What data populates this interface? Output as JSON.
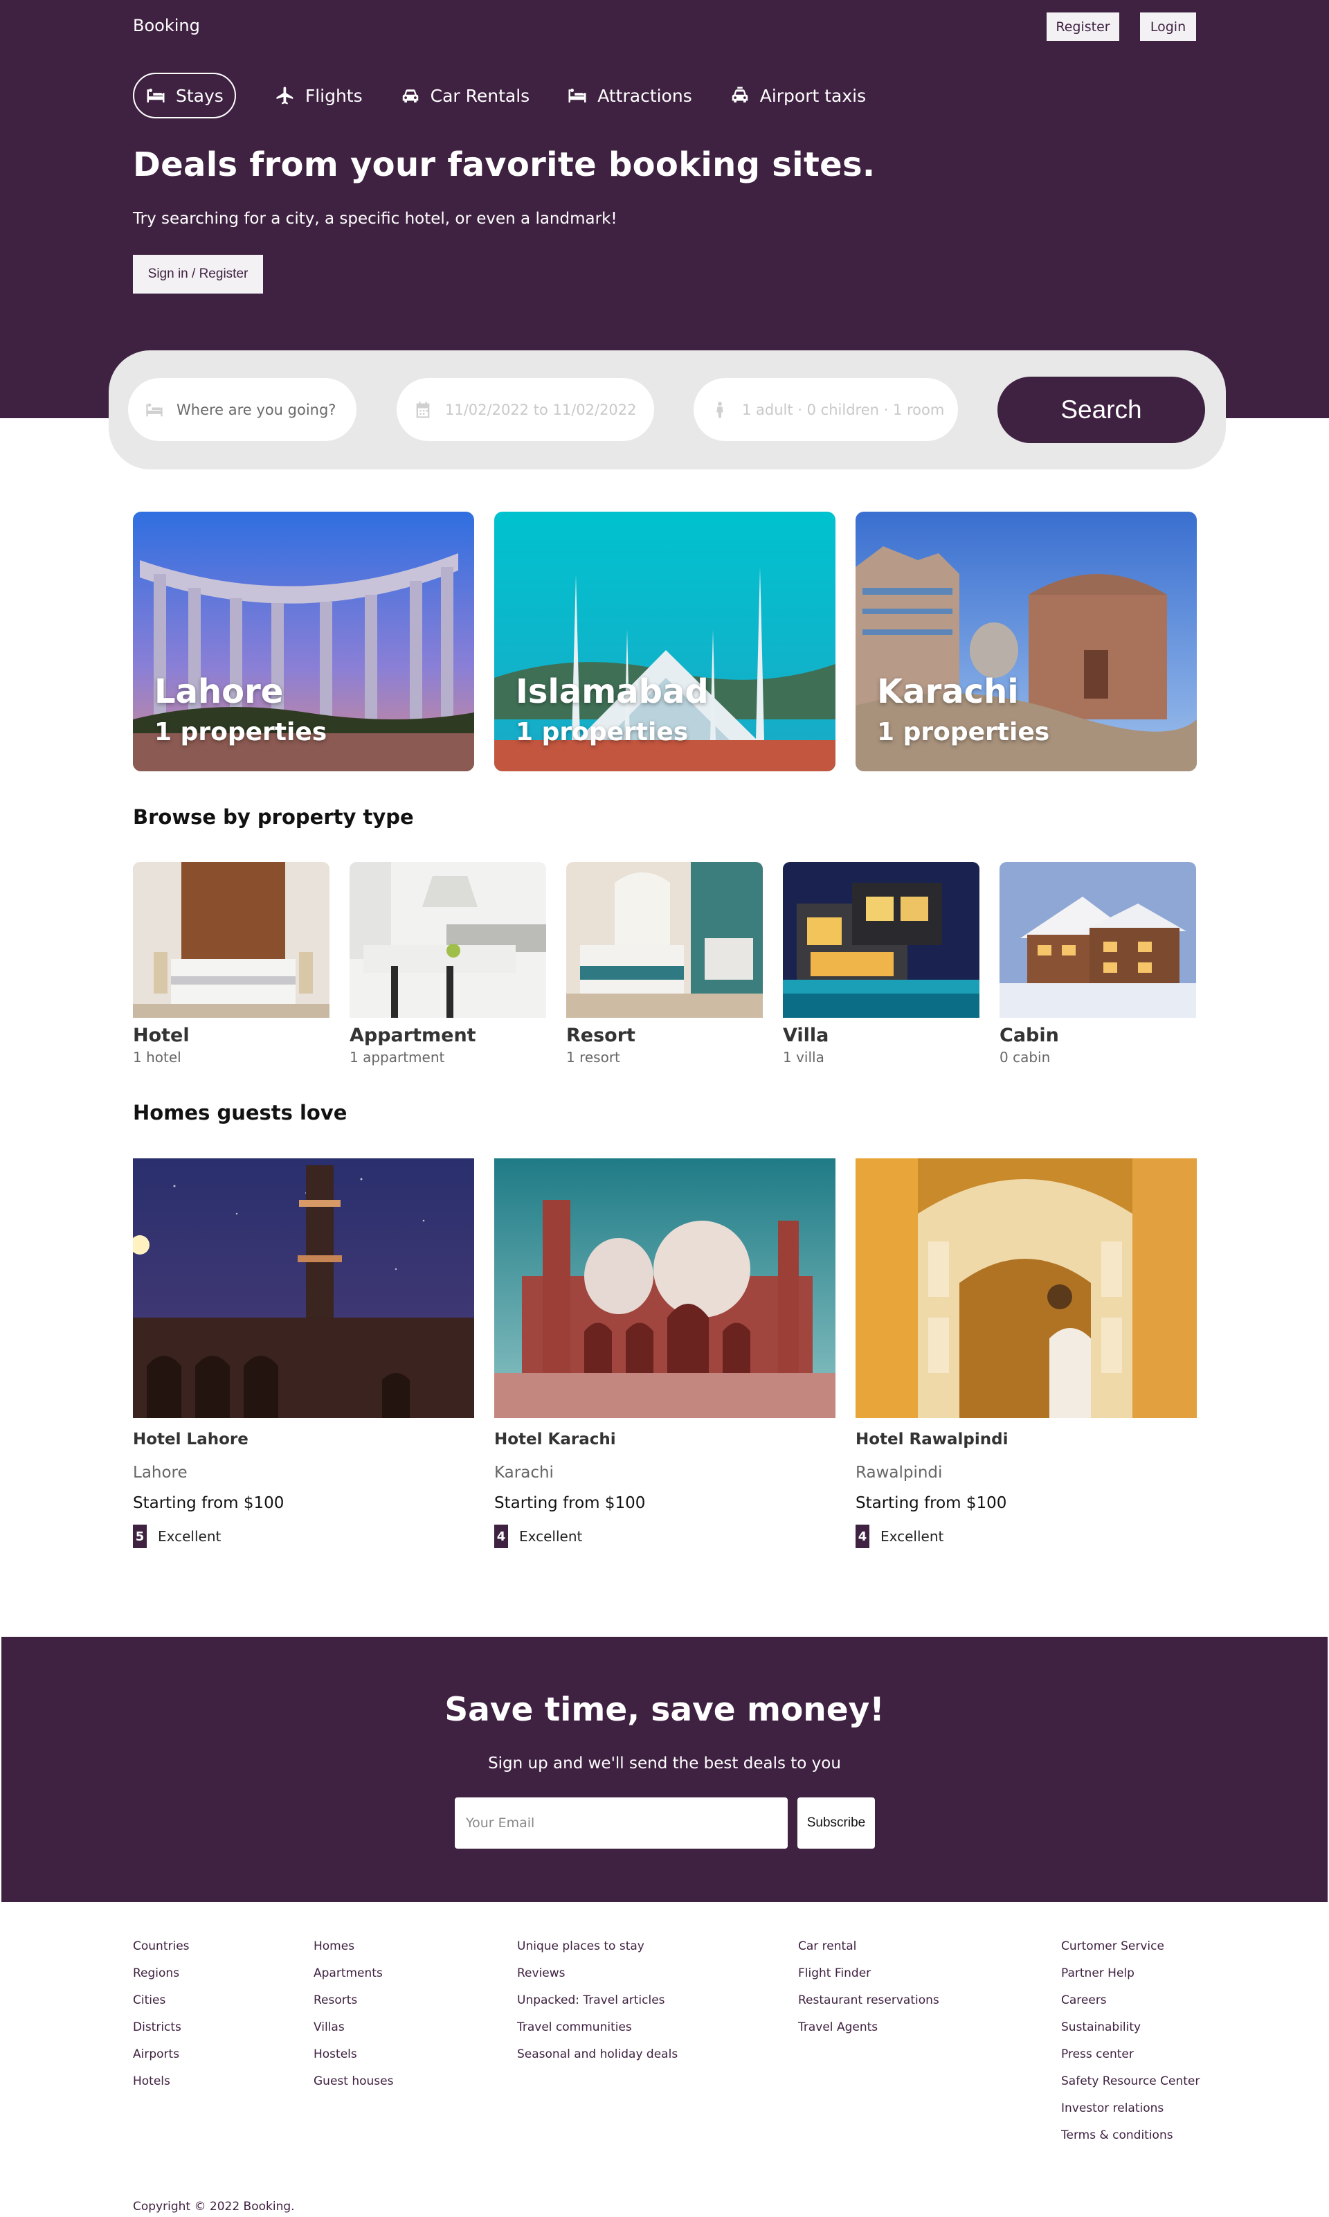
{
  "header": {
    "brand": "Booking",
    "register_label": "Register",
    "login_label": "Login",
    "nav": [
      {
        "label": "Stays",
        "icon": "bed-icon"
      },
      {
        "label": "Flights",
        "icon": "plane-icon"
      },
      {
        "label": "Car Rentals",
        "icon": "car-icon"
      },
      {
        "label": "Attractions",
        "icon": "bed-icon"
      },
      {
        "label": "Airport taxis",
        "icon": "taxi-icon"
      }
    ],
    "title": "Deals from your favorite booking sites.",
    "subtitle": "Try searching for a city, a specific hotel, or even a landmark!",
    "signin_label": "Sign in / Register"
  },
  "search": {
    "destination_placeholder": "Where are you going?",
    "dates": "11/02/2022 to 11/02/2022",
    "guests": "1 adult · 0 children · 1 room",
    "button_label": "Search"
  },
  "cities": [
    {
      "name": "Lahore",
      "count": "1 properties"
    },
    {
      "name": "Islamabad",
      "count": "1 properties"
    },
    {
      "name": "Karachi",
      "count": "1 properties"
    }
  ],
  "property_types": {
    "title": "Browse by property type",
    "items": [
      {
        "name": "Hotel",
        "count": "1 hotel"
      },
      {
        "name": "Appartment",
        "count": "1 appartment"
      },
      {
        "name": "Resort",
        "count": "1 resort"
      },
      {
        "name": "Villa",
        "count": "1 villa"
      },
      {
        "name": "Cabin",
        "count": "0 cabin"
      }
    ]
  },
  "homes": {
    "title": "Homes guests love",
    "items": [
      {
        "name": "Hotel Lahore",
        "city": "Lahore",
        "price": "Starting from $100",
        "score": "5",
        "rating": "Excellent"
      },
      {
        "name": "Hotel Karachi",
        "city": "Karachi",
        "price": "Starting from $100",
        "score": "4",
        "rating": "Excellent"
      },
      {
        "name": "Hotel Rawalpindi",
        "city": "Rawalpindi",
        "price": "Starting from $100",
        "score": "4",
        "rating": "Excellent"
      }
    ]
  },
  "newsletter": {
    "title": "Save time, save money!",
    "subtitle": "Sign up and we'll send the best deals to you",
    "email_placeholder": "Your Email",
    "subscribe_label": "Subscribe"
  },
  "footer": {
    "columns": [
      [
        "Countries",
        "Regions",
        "Cities",
        "Districts",
        "Airports",
        "Hotels"
      ],
      [
        "Homes",
        "Apartments",
        "Resorts",
        "Villas",
        "Hostels",
        "Guest houses"
      ],
      [
        "Unique places to stay",
        "Reviews",
        "Unpacked: Travel articles",
        "Travel communities",
        "Seasonal and holiday deals"
      ],
      [
        "Car rental",
        "Flight Finder",
        "Restaurant reservations",
        "Travel Agents"
      ],
      [
        "Curtomer Service",
        "Partner Help",
        "Careers",
        "Sustainability",
        "Press center",
        "Safety Resource Center",
        "Investor relations",
        "Terms & conditions"
      ]
    ],
    "copyright": "Copyright © 2022 Booking."
  },
  "colors": {
    "brand": "#3f2141",
    "search_bg": "#e8e8e8"
  }
}
